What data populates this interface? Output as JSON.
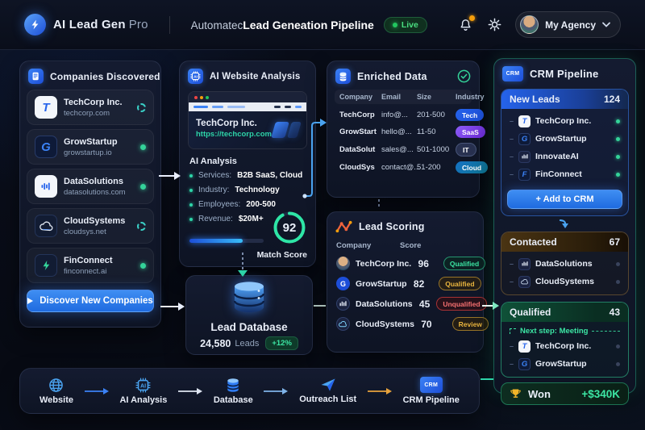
{
  "colors": {
    "accent_blue": "#2f7df6",
    "accent_teal": "#34d399",
    "amber": "#e8a33d",
    "red": "#ef4444",
    "purple": "#8b5cf6"
  },
  "icons": {
    "brand_logo": "bolt-circle",
    "header_right": [
      "bell",
      "gear",
      "avatar",
      "chevron-down"
    ],
    "panel_headers": [
      "document",
      "ai-chip",
      "database",
      "scatter-chart",
      "crm-badge"
    ],
    "enriched_status": "check-circle",
    "won": "trophy",
    "flow_steps": [
      "globe",
      "ai-chip",
      "database",
      "paper-plane",
      "crm-badge"
    ]
  },
  "header": {
    "brand_bold": "AI Lead Gen",
    "brand_light": "Pro",
    "title_prefix": "Automatec",
    "title_main": "Lead Geneation Pipeline",
    "live_label": "Live",
    "account_label": "My Agency"
  },
  "companies": {
    "title": "Companies Discovered",
    "items": [
      {
        "name": "TechCorp Inc.",
        "domain": "techcorp.com",
        "status": "loading"
      },
      {
        "name": "GrowStartup",
        "domain": "growstartup.io",
        "status": "done"
      },
      {
        "name": "DataSolutions",
        "domain": "datasolutions.com",
        "status": "done"
      },
      {
        "name": "CloudSystems",
        "domain": "cloudsys.net",
        "status": "loading"
      },
      {
        "name": "FinConnect",
        "domain": "finconnect.ai",
        "status": "done"
      }
    ],
    "discover_button": "Discover New Companies"
  },
  "analysis": {
    "title": "AI Website Analysis",
    "site_name": "TechCorp Inc.",
    "site_url": "https://techcorp.com",
    "section_title": "AI Analysis",
    "bullets": [
      {
        "label": "Services:",
        "value": "B2B SaaS, Cloud"
      },
      {
        "label": "Industry:",
        "value": "Technology"
      },
      {
        "label": "Employees:",
        "value": "200-500"
      },
      {
        "label": "Revenue:",
        "value": "$20M+"
      }
    ],
    "progress_pct": 72,
    "match_score": "92",
    "match_label": "Match Score"
  },
  "database": {
    "title": "Lead Database",
    "count": "24,580",
    "unit": "Leads",
    "delta": "+12%"
  },
  "enriched": {
    "title": "Enriched Data",
    "columns": [
      "Company",
      "Email",
      "Size",
      "Industry"
    ],
    "rows": [
      {
        "company": "TechCorp",
        "email": "info@...",
        "size": "201-500",
        "industry": "Tech"
      },
      {
        "company": "GrowStart",
        "email": "hello@...",
        "size": "11-50",
        "industry": "SaaS"
      },
      {
        "company": "DataSolut",
        "email": "sales@...",
        "size": "501-1000",
        "industry": "IT"
      },
      {
        "company": "CloudSys",
        "email": "contact@...",
        "size": "51-200",
        "industry": "Cloud"
      }
    ]
  },
  "scoring": {
    "title": "Lead Scoring",
    "col_company": "Company",
    "col_score": "Score",
    "rows": [
      {
        "company": "TechCorp Inc.",
        "score": "96",
        "status": "Qualified"
      },
      {
        "company": "GrowStartup",
        "score": "82",
        "status": "Qualified"
      },
      {
        "company": "DataSolutions",
        "score": "45",
        "status": "Unqualified"
      },
      {
        "company": "CloudSystems",
        "score": "70",
        "status": "Review"
      }
    ]
  },
  "crm": {
    "title": "CRM Pipeline",
    "new_leads": {
      "name": "New Leads",
      "count": "124",
      "items": [
        "TechCorp Inc.",
        "GrowStartup",
        "InnovateAI",
        "FinConnect"
      ]
    },
    "add_button": "+ Add to CRM",
    "contacted": {
      "name": "Contacted",
      "count": "67",
      "items": [
        "DataSolutions",
        "CloudSystems"
      ]
    },
    "qualified": {
      "name": "Qualified",
      "count": "43",
      "note": "Next step: Meeting",
      "items": [
        "TechCorp Inc.",
        "GrowStartup"
      ]
    },
    "won": {
      "label": "Won",
      "value": "+$340K"
    }
  },
  "flow": {
    "steps": [
      "Website",
      "AI Analysis",
      "Database",
      "Outreach List",
      "CRM Pipeline"
    ]
  }
}
